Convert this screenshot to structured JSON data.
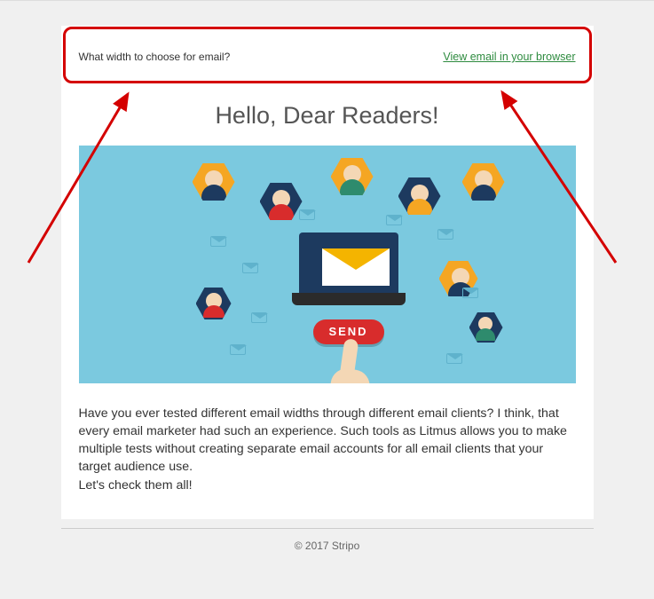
{
  "preheader": {
    "subject": "What width to choose for email?",
    "view_link": "View email in your browser"
  },
  "headline": "Hello, Dear Readers!",
  "hero": {
    "send_button": "SEND"
  },
  "body": {
    "p1": "Have you ever tested different email widths through different email clients? I think, that every email marketer had such an experience. Such tools as Litmus allows you to make multiple tests without creating separate email accounts for all email clients that your target audience use.",
    "p2": "Let's check them all!"
  },
  "footer": {
    "copyright": "© 2017 Stripo"
  },
  "annotation": {
    "box_color": "#d40000"
  }
}
